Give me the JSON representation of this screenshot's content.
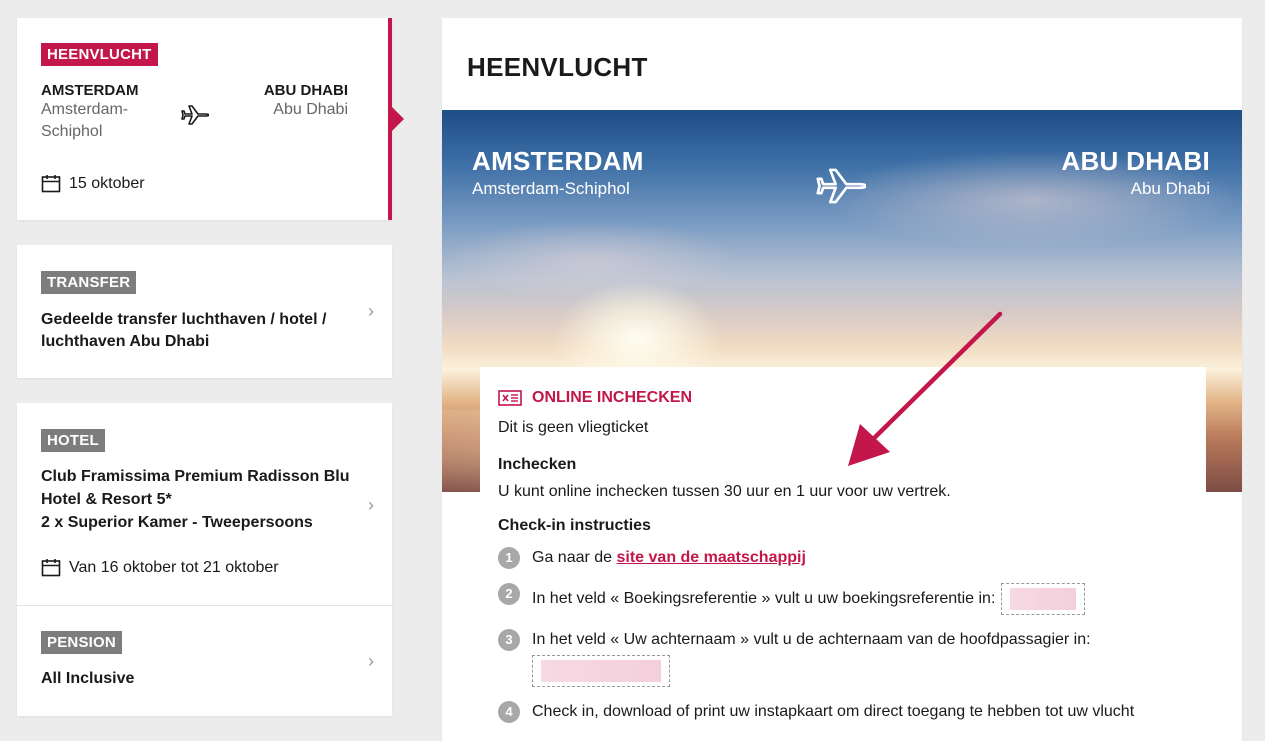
{
  "flight_card": {
    "badge": "HEENVLUCHT",
    "from_city": "AMSTERDAM",
    "from_airport": "Amsterdam-Schiphol",
    "to_city": "ABU DHABI",
    "to_airport": "Abu Dhabi",
    "date": "15 oktober"
  },
  "transfer_card": {
    "badge": "TRANSFER",
    "text": "Gedeelde transfer luchthaven / hotel / luchthaven Abu Dhabi",
    "chevron": "›"
  },
  "hotel_card": {
    "badge": "HOTEL",
    "name_line1": "Club Framissima Premium Radisson Blu",
    "name_line2": "Hotel & Resort 5*",
    "room": "2 x Superior Kamer - Tweepersoons",
    "dates": "Van 16 oktober tot 21 oktober",
    "pension_badge": "PENSION",
    "pension": "All Inclusive",
    "chevron": "›"
  },
  "main": {
    "title": "HEENVLUCHT",
    "hero": {
      "from_city": "AMSTERDAM",
      "from_airport": "Amsterdam-Schiphol",
      "to_city": "ABU DHABI",
      "to_airport": "Abu Dhabi"
    },
    "checkin": {
      "heading": "ONLINE INCHECKEN",
      "subtitle": "Dit is geen vliegticket",
      "section1_title": "Inchecken",
      "section1_text": "U kunt online inchecken tussen 30 uur en 1 uur voor uw vertrek.",
      "section2_title": "Check-in instructies",
      "step1_prefix": "Ga naar de ",
      "step1_link": "site van de maatschappij",
      "step2": "In het veld « Boekingsreferentie » vult u uw boekingsreferentie in:",
      "step3": "In het veld « Uw achternaam » vult u de achternaam van de hoofdpassagier in:",
      "step4": "Check in, download of print uw instapkaart om direct toegang te hebben tot uw vlucht"
    }
  },
  "colors": {
    "accent": "#c3164a",
    "badge_grey": "#7d7d7d",
    "background": "#ececec"
  },
  "icons": [
    "plane-icon",
    "calendar-icon",
    "ticket-icon",
    "chevron-right-icon",
    "arrow-annotation"
  ]
}
